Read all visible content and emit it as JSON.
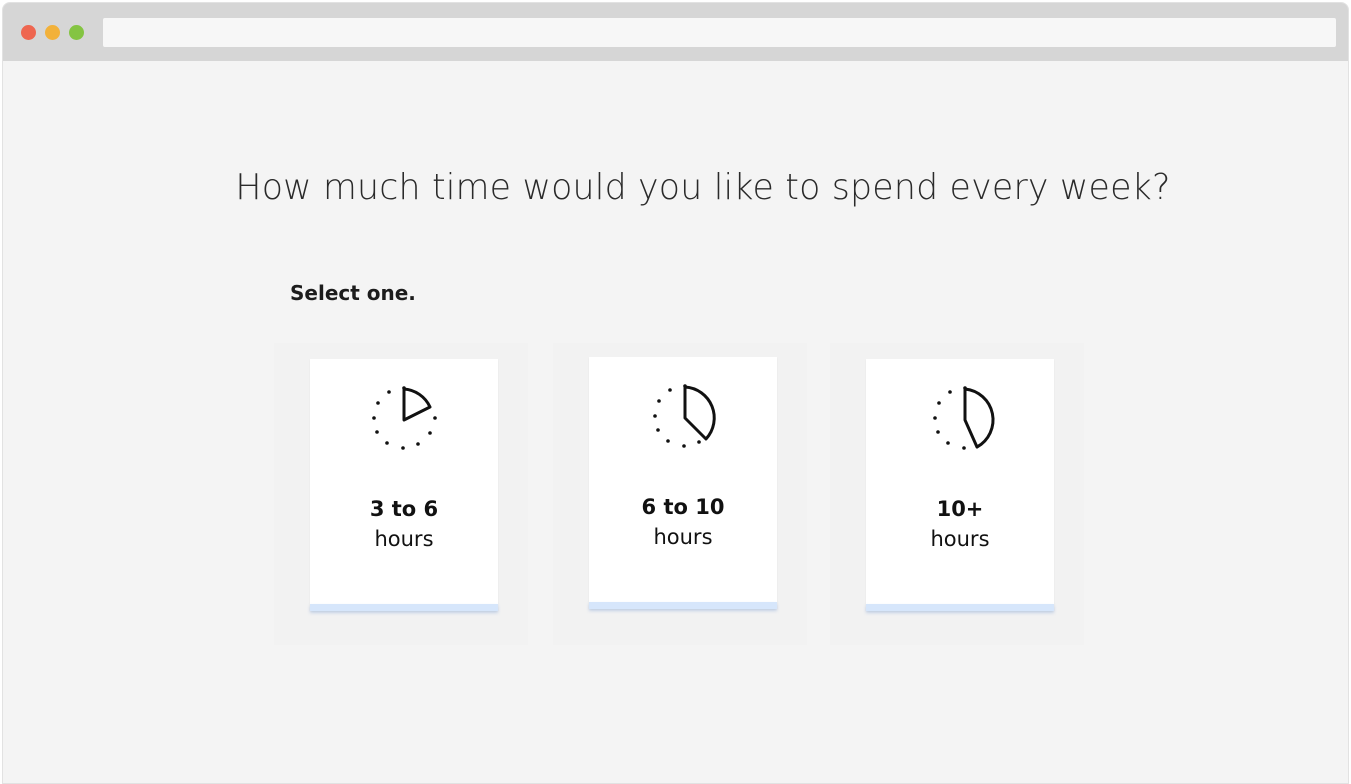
{
  "window": {
    "controls": {
      "close_color": "#ee6650",
      "minimize_color": "#f2b13a",
      "maximize_color": "#84c442"
    },
    "address_bar": ""
  },
  "page": {
    "headline": "How much time would you like to spend every week?",
    "instruction": "Select one."
  },
  "options": [
    {
      "amount": "3 to 6",
      "unit": "hours",
      "icon": "clock-quarter-icon"
    },
    {
      "amount": "6 to 10",
      "unit": "hours",
      "icon": "clock-third-icon"
    },
    {
      "amount": "10+",
      "unit": "hours",
      "icon": "clock-half-icon"
    }
  ],
  "colors": {
    "background": "#f4f4f4",
    "card": "#ffffff",
    "accent": "#d6e6fb",
    "text": "#111111"
  }
}
